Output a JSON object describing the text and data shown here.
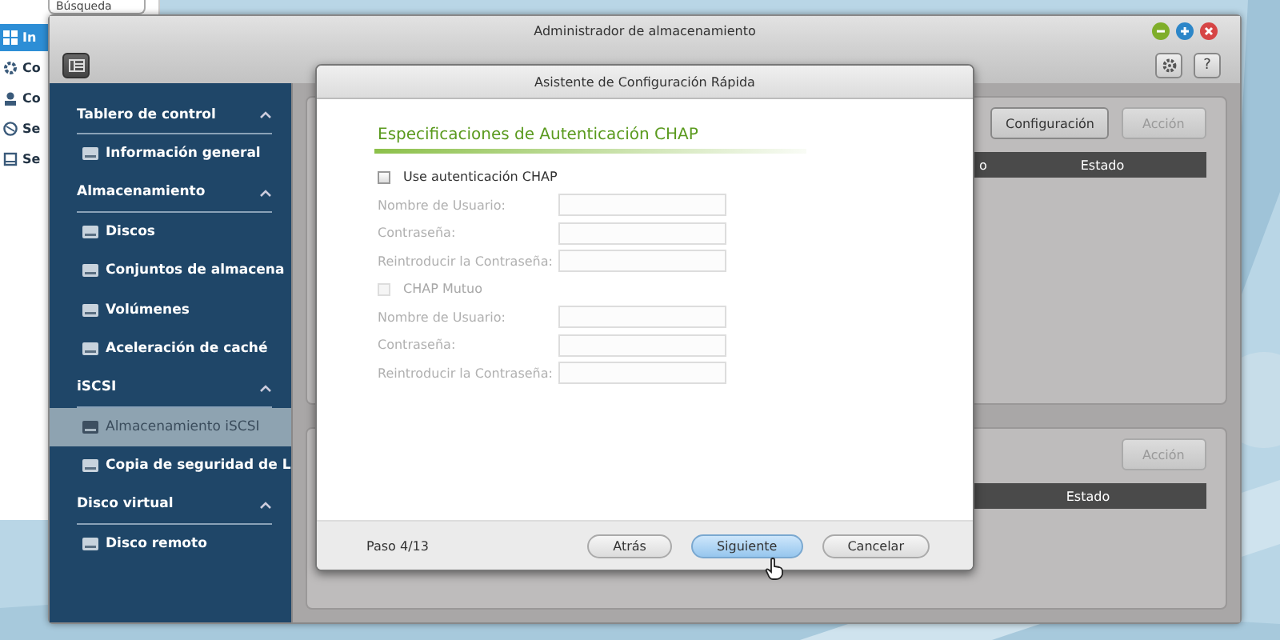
{
  "desktop_panel": {
    "search": {
      "value": "Búsqueda"
    },
    "items": [
      {
        "label": "In",
        "selected": true
      },
      {
        "label": "Co",
        "selected": false
      },
      {
        "label": "Co",
        "selected": false
      },
      {
        "label": "Se",
        "selected": false
      },
      {
        "label": "Se",
        "selected": false
      }
    ]
  },
  "window": {
    "title": "Administrador de almacenamiento",
    "help_label": "?"
  },
  "sidebar": {
    "sections": [
      {
        "title": "Tablero de control",
        "expanded": true,
        "items": [
          {
            "label": "Información general",
            "selected": false
          }
        ]
      },
      {
        "title": "Almacenamiento",
        "expanded": true,
        "items": [
          {
            "label": "Discos",
            "selected": false
          },
          {
            "label": "Conjuntos de almacena",
            "selected": false
          },
          {
            "label": "Volúmenes",
            "selected": false
          },
          {
            "label": "Aceleración de caché",
            "selected": false
          }
        ]
      },
      {
        "title": "iSCSI",
        "expanded": true,
        "items": [
          {
            "label": "Almacenamiento iSCSI",
            "selected": true
          },
          {
            "label": "Copia de seguridad de L",
            "selected": false
          }
        ]
      },
      {
        "title": "Disco virtual",
        "expanded": true,
        "items": [
          {
            "label": "Disco remoto",
            "selected": false
          }
        ]
      }
    ]
  },
  "upper_panel": {
    "buttons": [
      {
        "label": "Configuración",
        "disabled": false
      },
      {
        "label": "Acción",
        "disabled": true
      }
    ],
    "columns": [
      "o",
      "Estado"
    ]
  },
  "lower_panel": {
    "buttons": [
      {
        "label": "Acción",
        "disabled": true
      }
    ],
    "columns": [
      "Estado"
    ]
  },
  "dialog": {
    "title": "Asistente de Configuración Rápida",
    "heading": "Especificaciones de Autenticación CHAP",
    "fields": [
      {
        "kind": "checkbox",
        "label": "Use autenticación CHAP",
        "checked": false,
        "disabled": false
      },
      {
        "kind": "text",
        "label": "Nombre de Usuario:",
        "disabled": true
      },
      {
        "kind": "text",
        "label": "Contraseña:",
        "disabled": true
      },
      {
        "kind": "text",
        "label": "Reintroducir la Contraseña:",
        "disabled": true
      },
      {
        "kind": "checkbox",
        "label": "CHAP Mutuo",
        "checked": false,
        "disabled": true
      },
      {
        "kind": "text",
        "label": "Nombre de Usuario:",
        "disabled": true
      },
      {
        "kind": "text",
        "label": "Contraseña:",
        "disabled": true
      },
      {
        "kind": "text",
        "label": "Reintroducir la Contraseña:",
        "disabled": true
      }
    ],
    "step": "Paso 4/13",
    "buttons": [
      {
        "label": "Atrás",
        "hovered": false
      },
      {
        "label": "Siguiente",
        "hovered": true
      },
      {
        "label": "Cancelar",
        "hovered": false
      }
    ]
  }
}
